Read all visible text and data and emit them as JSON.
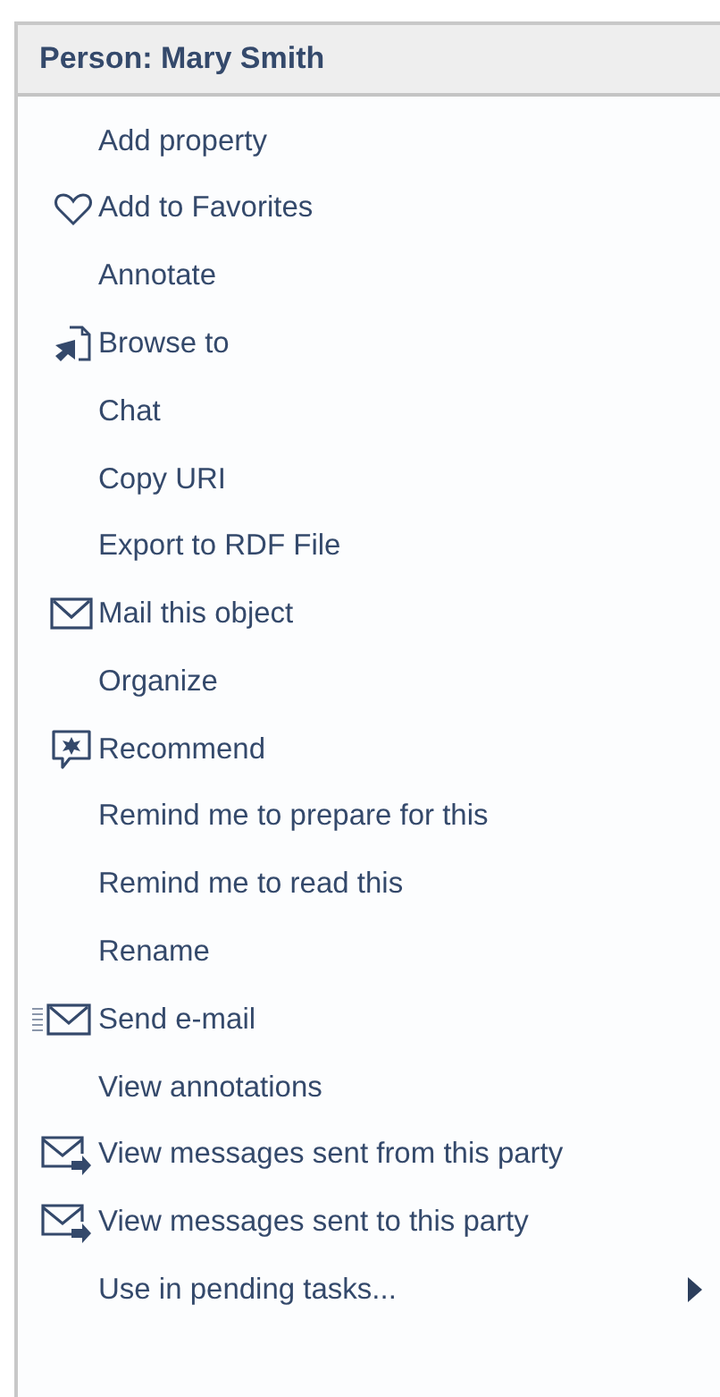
{
  "menu": {
    "title": "Person: Mary Smith",
    "items": [
      {
        "label": "Add property",
        "kind": "plain",
        "submenu": false
      },
      {
        "label": "Add to Favorites",
        "kind": "heart",
        "submenu": false
      },
      {
        "label": "Annotate",
        "kind": "plain",
        "submenu": false
      },
      {
        "label": "Browse to",
        "kind": "browse",
        "submenu": false
      },
      {
        "label": "Chat",
        "kind": "plain",
        "submenu": false
      },
      {
        "label": "Copy URI",
        "kind": "plain",
        "submenu": false
      },
      {
        "label": "Export to RDF File",
        "kind": "plain",
        "submenu": false
      },
      {
        "label": "Mail this object",
        "kind": "mail",
        "submenu": false
      },
      {
        "label": "Organize",
        "kind": "plain",
        "submenu": false
      },
      {
        "label": "Recommend",
        "kind": "recommend",
        "submenu": false
      },
      {
        "label": "Remind me to prepare for this",
        "kind": "plain",
        "submenu": false
      },
      {
        "label": "Remind me to read this",
        "kind": "plain",
        "submenu": false
      },
      {
        "label": "Rename",
        "kind": "plain",
        "submenu": false
      },
      {
        "label": "Send e-mail",
        "kind": "sendmail",
        "submenu": false
      },
      {
        "label": "View annotations",
        "kind": "plain",
        "submenu": false
      },
      {
        "label": "View messages sent from this party",
        "kind": "messages",
        "submenu": false
      },
      {
        "label": "View messages sent to this party",
        "kind": "messages",
        "submenu": false
      },
      {
        "label": "Use in pending tasks...",
        "kind": "plain",
        "submenu": true
      }
    ]
  }
}
